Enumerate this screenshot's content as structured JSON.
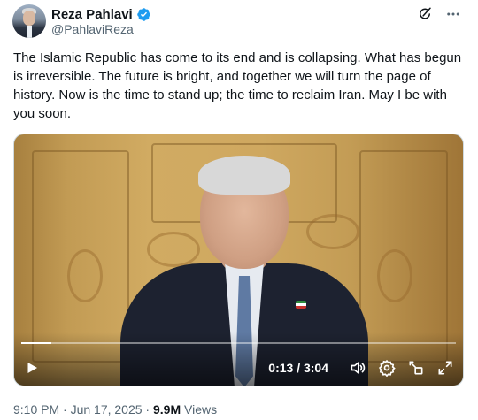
{
  "author": {
    "display_name": "Reza Pahlavi",
    "handle": "@PahlaviReza",
    "verified": true
  },
  "icons": {
    "verified": "verified-badge-icon",
    "grok": "grok-icon",
    "more": "more-icon",
    "play": "play-icon",
    "volume": "volume-icon",
    "settings": "settings-icon",
    "pip": "picture-in-picture-icon",
    "fullscreen": "fullscreen-icon"
  },
  "tweet": {
    "text": "The Islamic Republic has come to its end and is collapsing. What has begun is irreversible. The future is bright, and together we will turn the page of history. Now is the time to stand up; the time to reclaim Iran. May I be with you soon."
  },
  "video": {
    "time_display": "0:13 / 3:04",
    "progress_fraction": 0.07
  },
  "meta": {
    "timestamp": "9:10 PM · Jun 17, 2025 ·",
    "views_count": "9.9M",
    "views_label": "Views"
  },
  "colors": {
    "verified_blue": "#1d9bf0",
    "text_primary": "#0f1419",
    "text_secondary": "#536471"
  }
}
